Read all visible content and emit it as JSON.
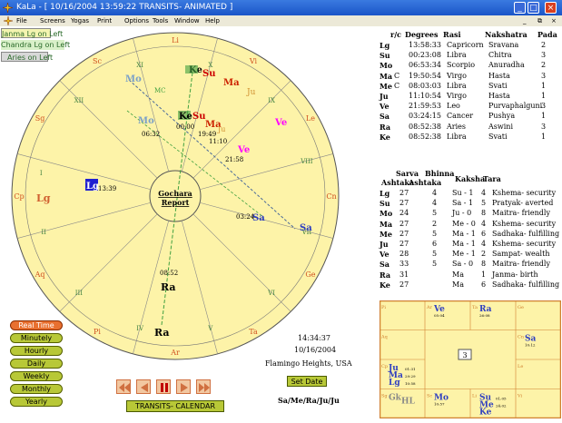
{
  "window": {
    "title": "KaLa - [ 10/16/2004  13:59:22   TRANSITS- ANIMATED ]",
    "minimize": "_",
    "maximize": "□",
    "close": "×",
    "restore": "⧉"
  },
  "menu": [
    "File",
    "Screens",
    "Yogas",
    "Print",
    "Options",
    "Tools",
    "Window",
    "Help"
  ],
  "lagna_buttons": [
    "Janma Lg on Left",
    "Chandra Lg on Left",
    "Aries on Left"
  ],
  "chart": {
    "center_label_1": "Gochara",
    "center_label_2": "Report",
    "signs": [
      "Li",
      "Vi",
      "Le",
      "Cn",
      "Ge",
      "Ta",
      "Ar",
      "Pi",
      "Aq",
      "Cp",
      "Sg",
      "Sc"
    ],
    "houses": [
      "I",
      "II",
      "III",
      "IV",
      "V",
      "VI",
      "VII",
      "VIII",
      "IX",
      "X",
      "XI",
      "XII"
    ],
    "natal_planets": [
      {
        "name": "Mo",
        "color": "#7aa0c8"
      },
      {
        "name": "Ke",
        "color": "#000000"
      },
      {
        "name": "Su",
        "color": "#cc0000"
      },
      {
        "name": "Ma",
        "color": "#cc2200"
      },
      {
        "name": "Ju",
        "color": "#d09030"
      },
      {
        "name": "Ve",
        "color": "#ff00ff"
      },
      {
        "name": "Lg",
        "color": "#d06030"
      },
      {
        "name": "Sa",
        "color": "#3040c0"
      },
      {
        "name": "Ra",
        "color": "#000000"
      }
    ],
    "transit_planets": [
      {
        "name": "Mo",
        "time": "06:32",
        "color": "#7aa0c8"
      },
      {
        "name": "Ke",
        "time": "08:52",
        "color": "#000000"
      },
      {
        "name": "Su",
        "time": "",
        "color": "#cc0000"
      },
      {
        "name": "Ma",
        "time": "19:49",
        "color": "#cc2200"
      },
      {
        "name": "Ju",
        "time": "11:10",
        "color": "#d09030"
      },
      {
        "name": "Ve",
        "time": "21:58",
        "color": "#ff00ff"
      },
      {
        "name": "Lg",
        "time": "13:39",
        "color": "#ffffff"
      },
      {
        "name": "Sa",
        "time": "03:24",
        "color": "#3040c0"
      },
      {
        "name": "Ra",
        "time": "08:52",
        "color": "#000000"
      }
    ],
    "extra_labels": {
      "mc": "MC",
      "merge": "00:00"
    }
  },
  "info": {
    "time": "14:34:37",
    "date": "10/16/2004",
    "place": "Flamingo Heights,  USA",
    "set_date": "Set Date",
    "planet_line": "Sa/Me/Ra/Ju/Ju"
  },
  "speed_buttons": [
    "Real Time",
    "Minutely",
    "Hourly",
    "Daily",
    "Weekly",
    "Monthly",
    "Yearly"
  ],
  "calendar_button": "TRANSITS- CALENDAR",
  "nav_buttons": [
    "rewind",
    "back",
    "pause",
    "forward",
    "fast-forward"
  ],
  "positions_table": {
    "headers": [
      "r/c",
      "Degrees",
      "Rasi",
      "Nakshatra",
      "Pada"
    ],
    "rows": [
      [
        "Lg",
        "",
        "13:58:33",
        "Capricorn",
        "Sravana",
        "2"
      ],
      [
        "Su",
        "",
        "00:23:08",
        "Libra",
        "Chitra",
        "3"
      ],
      [
        "Mo",
        "",
        "06:53:34",
        "Scorpio",
        "Anuradha",
        "2"
      ],
      [
        "Ma",
        "C",
        "19:50:54",
        "Virgo",
        "Hasta",
        "3"
      ],
      [
        "Me",
        "C",
        "08:03:03",
        "Libra",
        "Svati",
        "1"
      ],
      [
        "Ju",
        "",
        "11:10:54",
        "Virgo",
        "Hasta",
        "1"
      ],
      [
        "Ve",
        "",
        "21:59:53",
        "Leo",
        "Purvaphalguni",
        "3"
      ],
      [
        "Sa",
        "",
        "03:24:15",
        "Cancer",
        "Pushya",
        "1"
      ],
      [
        "Ra",
        "",
        "08:52:38",
        "Aries",
        "Aswini",
        "3"
      ],
      [
        "Ke",
        "",
        "08:52:38",
        "Libra",
        "Svati",
        "1"
      ]
    ]
  },
  "ashtaka_table": {
    "headers": [
      "Sarva Ashtaka",
      "Bhinna Ashtaka",
      "Kaksha",
      "Tara"
    ],
    "header_top": [
      "Sarva",
      "Bhinna",
      "Kaksha",
      "Tara"
    ],
    "header_bottom": [
      "Ashtaka",
      "Ashtaka"
    ],
    "rows": [
      [
        "Lg",
        "27",
        "4",
        "Su - 1",
        "4",
        "Kshema- security"
      ],
      [
        "Su",
        "27",
        "4",
        "Sa - 1",
        "5",
        "Pratyak- averted"
      ],
      [
        "Mo",
        "24",
        "5",
        "Ju - 0",
        "8",
        "Maitra- friendly"
      ],
      [
        "Ma",
        "27",
        "2",
        "Me - 0",
        "4",
        "Kshema- security"
      ],
      [
        "Me",
        "27",
        "5",
        "Ma - 1",
        "6",
        "Sadhaka- fulfilling"
      ],
      [
        "Ju",
        "27",
        "6",
        "Ma - 1",
        "4",
        "Kshema- security"
      ],
      [
        "Ve",
        "28",
        "5",
        "Me - 1",
        "2",
        "Sampat- wealth"
      ],
      [
        "Sa",
        "33",
        "5",
        "Sa - 0",
        "8",
        "Maitra- friendly"
      ],
      [
        "Ra",
        "31",
        "",
        "Ma",
        "1",
        "Janma- birth"
      ],
      [
        "Ke",
        "27",
        "",
        "Ma",
        "6",
        "Sadhaka- fulfilling"
      ]
    ]
  },
  "square_chart": {
    "cells": [
      {
        "sign": "Pi",
        "planets": []
      },
      {
        "sign": "Ar",
        "planets": [
          {
            "name": "Ve",
            "deg": "05:04"
          }
        ]
      },
      {
        "sign": "Ta",
        "planets": [
          {
            "name": "Ra",
            "deg": "26:08"
          }
        ]
      },
      {
        "sign": "Ge",
        "planets": []
      },
      {
        "sign": "Cn",
        "planets": [
          {
            "name": "Sa",
            "deg": "10:12"
          }
        ]
      },
      {
        "sign": "Le",
        "planets": []
      },
      {
        "sign": "Vi",
        "planets": []
      },
      {
        "sign": "Li",
        "planets": [
          {
            "name": "Su",
            "deg": "01:05"
          },
          {
            "name": "Me",
            "deg": "24:02"
          },
          {
            "name": "Ke",
            "deg": ""
          }
        ]
      },
      {
        "sign": "Sc",
        "planets": [
          {
            "name": "Mo",
            "deg": "10:57"
          }
        ]
      },
      {
        "sign": "Sg",
        "planets": [
          {
            "name": "Gk",
            "deg": ""
          },
          {
            "name": "HL",
            "deg": ""
          }
        ]
      },
      {
        "sign": "Cp",
        "planets": [
          {
            "name": "Ju",
            "deg": "01:31"
          },
          {
            "name": "Ma",
            "deg": "29:29"
          },
          {
            "name": "Lg",
            "deg": "10:58"
          }
        ]
      },
      {
        "sign": "Aq",
        "planets": []
      }
    ],
    "center_value": "3"
  }
}
